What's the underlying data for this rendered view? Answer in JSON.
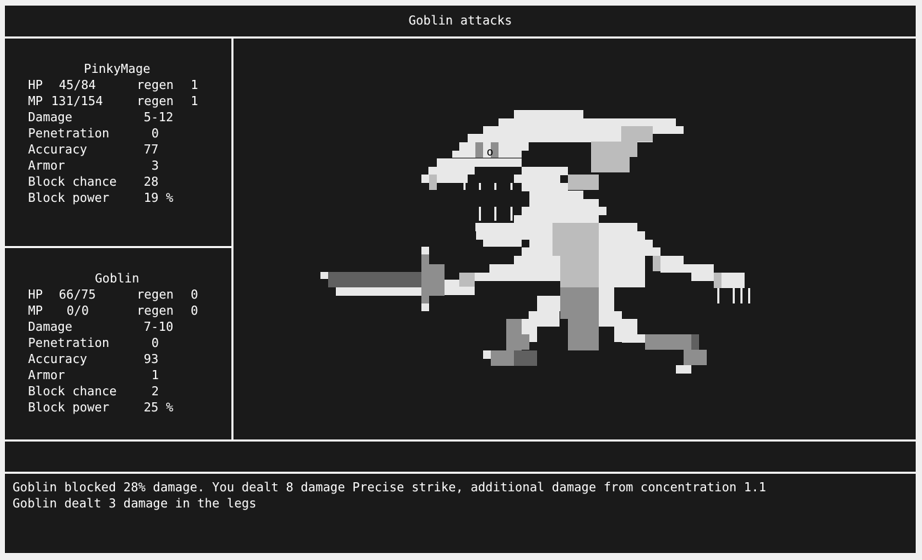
{
  "title": "Goblin attacks",
  "player": {
    "name": "PinkyMage",
    "stats": [
      {
        "label": "HP",
        "value": "45/84",
        "regen_label": "regen",
        "regen": "1"
      },
      {
        "label": "MP",
        "value": "131/154",
        "regen_label": "regen",
        "regen": "1"
      },
      {
        "label": "Damage",
        "value": "5-12"
      },
      {
        "label": "Penetration",
        "value": "0"
      },
      {
        "label": "Accuracy",
        "value": "77"
      },
      {
        "label": "Armor",
        "value": "3"
      },
      {
        "label": "Block chance",
        "value": "28"
      },
      {
        "label": "Block power",
        "value": "19 %"
      }
    ]
  },
  "enemy": {
    "name": "Goblin",
    "stats": [
      {
        "label": "HP",
        "value": "66/75",
        "regen_label": "regen",
        "regen": "0"
      },
      {
        "label": "MP",
        "value": "0/0",
        "regen_label": "regen",
        "regen": "0"
      },
      {
        "label": "Damage",
        "value": "7-10"
      },
      {
        "label": "Penetration",
        "value": "0"
      },
      {
        "label": "Accuracy",
        "value": "93"
      },
      {
        "label": "Armor",
        "value": "1"
      },
      {
        "label": "Block chance",
        "value": "2"
      },
      {
        "label": "Block power",
        "value": "25 %"
      }
    ]
  },
  "sprite": {
    "name": "goblin-with-sword",
    "eye_glyph": "o"
  },
  "action_text": "",
  "log": [
    "Goblin blocked 28% damage. You dealt 8 damage Precise strike, additional damage from concentration 1.1",
    "Goblin dealt 3 damage in the legs"
  ],
  "colors": {
    "background": "#1a1a1a",
    "frame": "#f0f0f0",
    "text": "#ffffff",
    "sprite_light": "#e8e8e8",
    "sprite_mid": "#bcbcbc",
    "sprite_dark": "#8e8e8e",
    "sprite_darkest": "#606060"
  }
}
